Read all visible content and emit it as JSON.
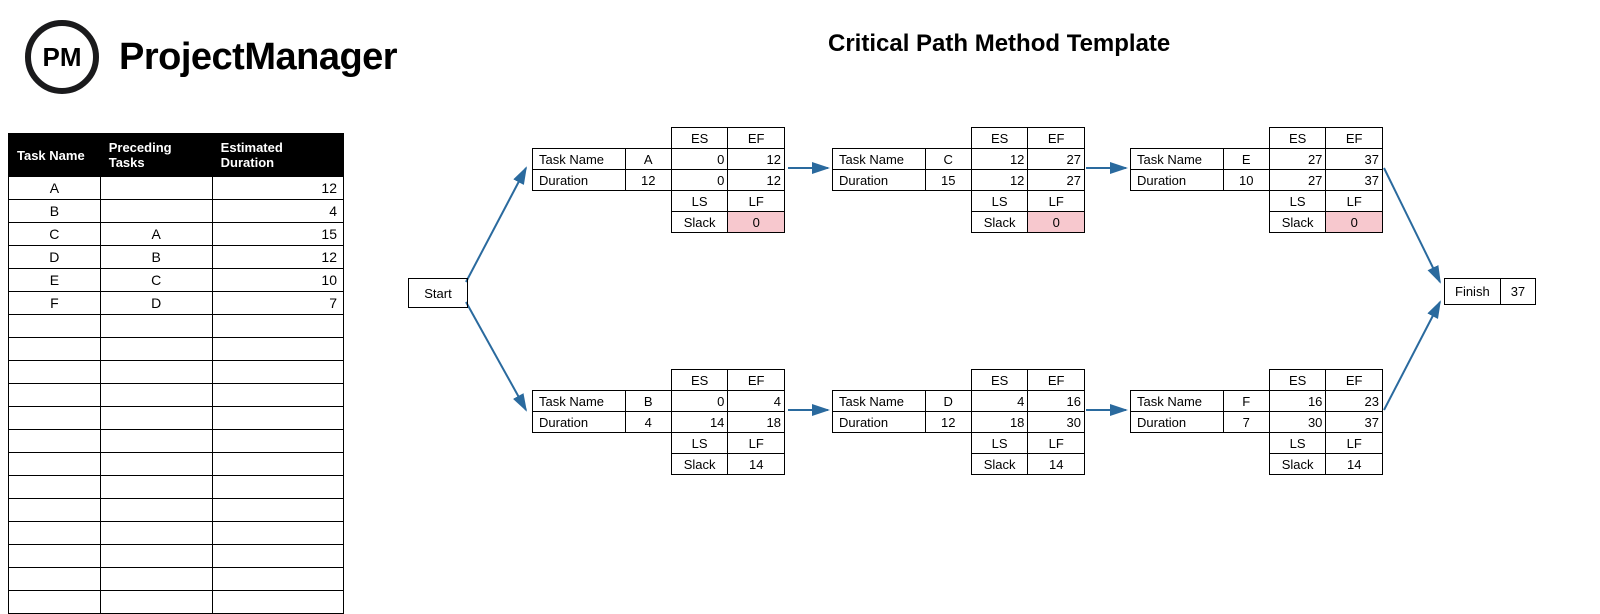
{
  "brand": {
    "initials": "PM",
    "name": "ProjectManager"
  },
  "title": "Critical Path Method Template",
  "table": {
    "headers": [
      "Task Name",
      "Preceding Tasks",
      "Estimated Duration"
    ],
    "rows": [
      {
        "name": "A",
        "pred": "",
        "dur": "12"
      },
      {
        "name": "B",
        "pred": "",
        "dur": "4"
      },
      {
        "name": "C",
        "pred": "A",
        "dur": "15"
      },
      {
        "name": "D",
        "pred": "B",
        "dur": "12"
      },
      {
        "name": "E",
        "pred": "C",
        "dur": "10"
      },
      {
        "name": "F",
        "pred": "D",
        "dur": "7"
      },
      {
        "name": "",
        "pred": "",
        "dur": ""
      },
      {
        "name": "",
        "pred": "",
        "dur": ""
      },
      {
        "name": "",
        "pred": "",
        "dur": ""
      },
      {
        "name": "",
        "pred": "",
        "dur": ""
      },
      {
        "name": "",
        "pred": "",
        "dur": ""
      },
      {
        "name": "",
        "pred": "",
        "dur": ""
      },
      {
        "name": "",
        "pred": "",
        "dur": ""
      },
      {
        "name": "",
        "pred": "",
        "dur": ""
      },
      {
        "name": "",
        "pred": "",
        "dur": ""
      },
      {
        "name": "",
        "pred": "",
        "dur": ""
      },
      {
        "name": "",
        "pred": "",
        "dur": ""
      },
      {
        "name": "",
        "pred": "",
        "dur": ""
      },
      {
        "name": "",
        "pred": "",
        "dur": ""
      }
    ]
  },
  "diagram": {
    "start": "Start",
    "finish_label": "Finish",
    "finish_value": "37",
    "labels": {
      "taskname": "Task Name",
      "duration": "Duration",
      "es": "ES",
      "ef": "EF",
      "ls": "LS",
      "lf": "LF",
      "slack": "Slack"
    },
    "nodes": {
      "A": {
        "name": "A",
        "dur": "12",
        "es": "0",
        "ef": "12",
        "ls": "0",
        "lf": "12",
        "slack": "0",
        "critical": true
      },
      "B": {
        "name": "B",
        "dur": "4",
        "es": "0",
        "ef": "4",
        "ls": "14",
        "lf": "18",
        "slack": "14",
        "critical": false
      },
      "C": {
        "name": "C",
        "dur": "15",
        "es": "12",
        "ef": "27",
        "ls": "12",
        "lf": "27",
        "slack": "0",
        "critical": true
      },
      "D": {
        "name": "D",
        "dur": "12",
        "es": "4",
        "ef": "16",
        "ls": "18",
        "lf": "30",
        "slack": "14",
        "critical": false
      },
      "E": {
        "name": "E",
        "dur": "10",
        "es": "27",
        "ef": "37",
        "ls": "27",
        "lf": "37",
        "slack": "0",
        "critical": true
      },
      "F": {
        "name": "F",
        "dur": "7",
        "es": "16",
        "ef": "23",
        "ls": "30",
        "lf": "37",
        "slack": "14",
        "critical": false
      }
    }
  }
}
